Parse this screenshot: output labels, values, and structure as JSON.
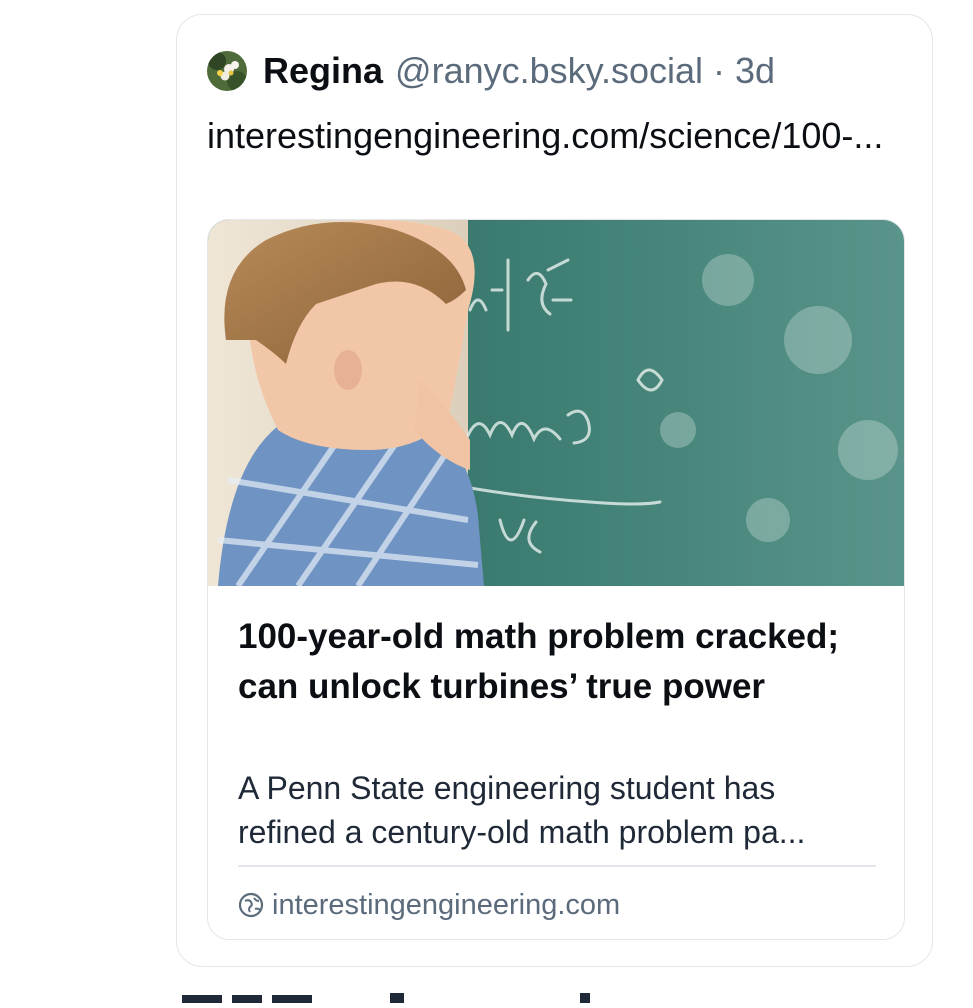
{
  "post": {
    "author_name": "Regina",
    "author_handle": "@ranyc.bsky.social",
    "separator": "·",
    "time": "3d",
    "text": "interestingengineering.com/science/100-..."
  },
  "link_card": {
    "image_icon": "boy-forehead-on-chalkboard-image",
    "title": "100-year-old math problem cracked; can unlock turbines’ true power",
    "description": "A Penn State engineering student has refined a century-old math problem pa...",
    "domain_icon": "globe-icon",
    "domain": "interestingengineering.com"
  },
  "colors": {
    "text_primary": "#0b0f14",
    "text_secondary": "#5b6b7c",
    "border": "#e3e6ea",
    "chalkboard": "#3f7f74"
  }
}
